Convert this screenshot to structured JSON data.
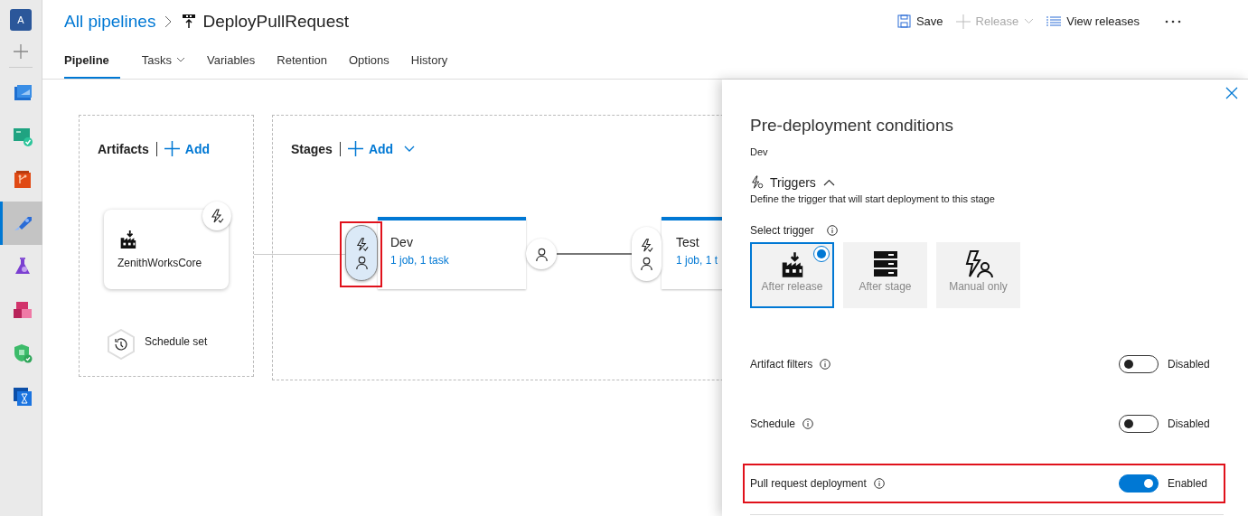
{
  "nav_rail": {
    "avatar": "A",
    "items": [
      {
        "kind": "overview",
        "selected": false
      },
      {
        "kind": "boards",
        "selected": false
      },
      {
        "kind": "repos",
        "selected": false
      },
      {
        "kind": "pipelines",
        "selected": true
      },
      {
        "kind": "test_plans",
        "selected": false
      },
      {
        "kind": "artifacts",
        "selected": false
      },
      {
        "kind": "security",
        "selected": false
      },
      {
        "kind": "load_test",
        "selected": false
      }
    ]
  },
  "header": {
    "breadcrumb": "All pipelines",
    "title": "DeployPullRequest",
    "actions": [
      {
        "kind": "save",
        "label": "Save",
        "disabled": false
      },
      {
        "kind": "release",
        "label": "Release",
        "disabled": true
      },
      {
        "kind": "view",
        "label": "View releases",
        "disabled": false
      }
    ]
  },
  "tabs": [
    {
      "label": "Pipeline",
      "selected": true,
      "menu": false
    },
    {
      "label": "Tasks",
      "selected": false,
      "menu": true
    },
    {
      "label": "Variables",
      "selected": false,
      "menu": false
    },
    {
      "label": "Retention",
      "selected": false,
      "menu": false
    },
    {
      "label": "Options",
      "selected": false,
      "menu": false
    },
    {
      "label": "History",
      "selected": false,
      "menu": false
    }
  ],
  "artifacts": {
    "heading": "Artifacts",
    "add": "Add",
    "card": "ZenithWorksCore",
    "schedule": "Schedule set"
  },
  "stages": {
    "heading": "Stages",
    "add": "Add",
    "items": [
      {
        "name": "Dev",
        "summary": "1 job, 1 task",
        "highlighted": true
      },
      {
        "name": "Test",
        "summary": "1 job, 1 t",
        "highlighted": false
      }
    ]
  },
  "panel": {
    "title": "Pre-deployment conditions",
    "subtitle": "Dev",
    "section": "Triggers",
    "expanded": true,
    "description": "Define the trigger that will start deployment to this stage",
    "select_label": "Select trigger",
    "trigger_options": [
      {
        "kind": "artifact",
        "label": "After release",
        "selected": true
      },
      {
        "kind": "stage",
        "label": "After stage",
        "selected": false
      },
      {
        "kind": "manual",
        "label": "Manual only",
        "selected": false
      }
    ],
    "settings": [
      {
        "label": "Artifact filters",
        "on": false,
        "status": "Disabled",
        "highlighted": false
      },
      {
        "label": "Schedule",
        "on": false,
        "status": "Disabled",
        "highlighted": false
      },
      {
        "label": "Pull request deployment",
        "on": true,
        "status": "Enabled",
        "highlighted": true
      }
    ]
  }
}
